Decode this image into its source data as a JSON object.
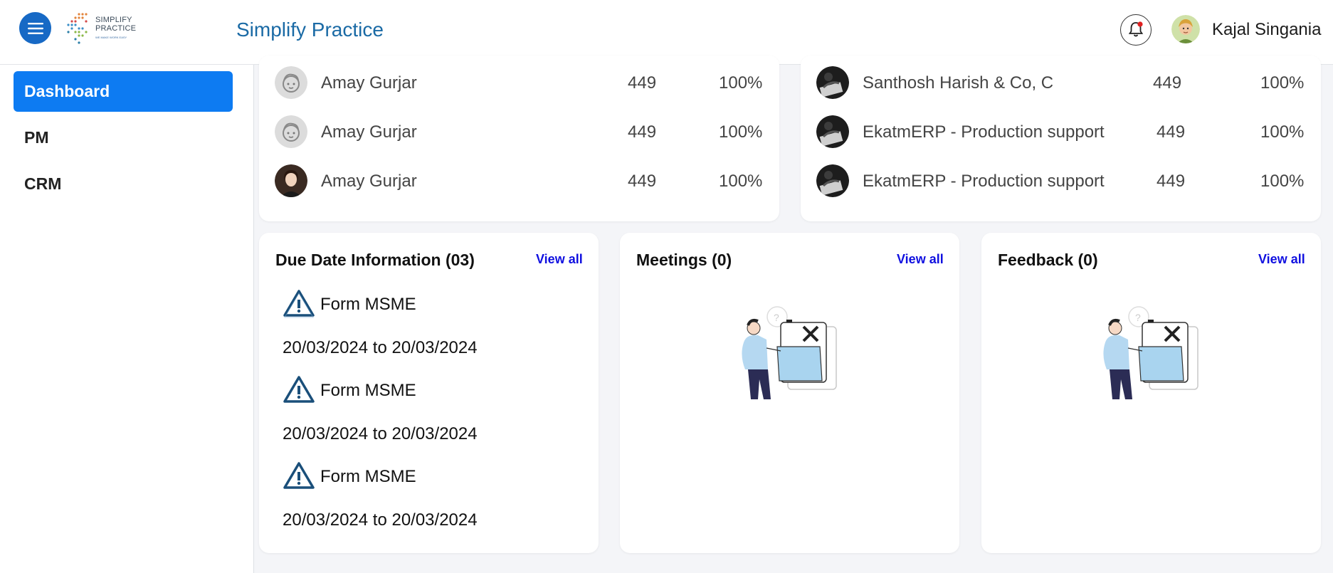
{
  "header": {
    "logo_text_line1": "SIMPLIFY",
    "logo_text_line2": "PRACTICE",
    "logo_tagline": "WE MAKE WORK EASY",
    "app_title": "Simplify Practice",
    "user_name": "Kajal Singania"
  },
  "sidebar": {
    "items": [
      {
        "label": "Dashboard",
        "active": true
      },
      {
        "label": "PM",
        "active": false
      },
      {
        "label": "CRM",
        "active": false
      }
    ]
  },
  "left_list": {
    "rows": [
      {
        "name": "Amay Gurjar",
        "count": "449",
        "percent": "100%",
        "avatar": "placeholder-face-icon"
      },
      {
        "name": "Amay Gurjar",
        "count": "449",
        "percent": "100%",
        "avatar": "placeholder-face-icon"
      },
      {
        "name": "Amay Gurjar",
        "count": "449",
        "percent": "100%",
        "avatar": "user-photo"
      }
    ]
  },
  "right_list": {
    "rows": [
      {
        "name": "Santhosh Harish & Co, C",
        "count": "449",
        "percent": "100%"
      },
      {
        "name": "EkatmERP - Production support",
        "count": "449",
        "percent": "100%"
      },
      {
        "name": "EkatmERP - Production support",
        "count": "449",
        "percent": "100%"
      }
    ]
  },
  "due_dates": {
    "title": "Due Date Information (03)",
    "view_all": "View all",
    "items": [
      {
        "name": "Form MSME",
        "range": "20/03/2024 to 20/03/2024"
      },
      {
        "name": "Form MSME",
        "range": "20/03/2024 to 20/03/2024"
      },
      {
        "name": "Form MSME",
        "range": "20/03/2024 to 20/03/2024"
      }
    ]
  },
  "meetings": {
    "title": "Meetings (0)",
    "view_all": "View all"
  },
  "feedback": {
    "title": "Feedback (0)",
    "view_all": "View all"
  },
  "colors": {
    "accent": "#0d7bf2",
    "menu": "#1769c5",
    "title": "#1a6aa5",
    "link": "#1010e0"
  }
}
